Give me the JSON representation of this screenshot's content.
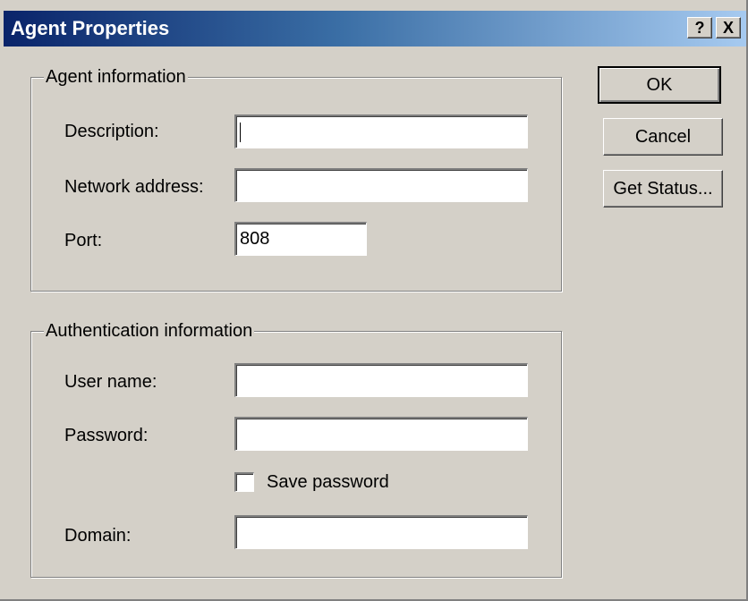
{
  "window": {
    "title": "Agent Properties",
    "help_label": "?",
    "close_label": "X"
  },
  "agent_info": {
    "legend": "Agent information",
    "description_label": "Description:",
    "description_value": "",
    "network_label": "Network address:",
    "network_value": "",
    "port_label": "Port:",
    "port_value": "808"
  },
  "auth_info": {
    "legend": "Authentication information",
    "username_label": "User name:",
    "username_value": "",
    "password_label": "Password:",
    "password_value": "",
    "save_password_label": "Save password",
    "save_password_checked": false,
    "domain_label": "Domain:",
    "domain_value": ""
  },
  "buttons": {
    "ok": "OK",
    "cancel": "Cancel",
    "get_status": "Get Status..."
  },
  "colors": {
    "titlebar_start": "#0a246a",
    "titlebar_end": "#a6caf0",
    "face": "#d4d0c8"
  }
}
